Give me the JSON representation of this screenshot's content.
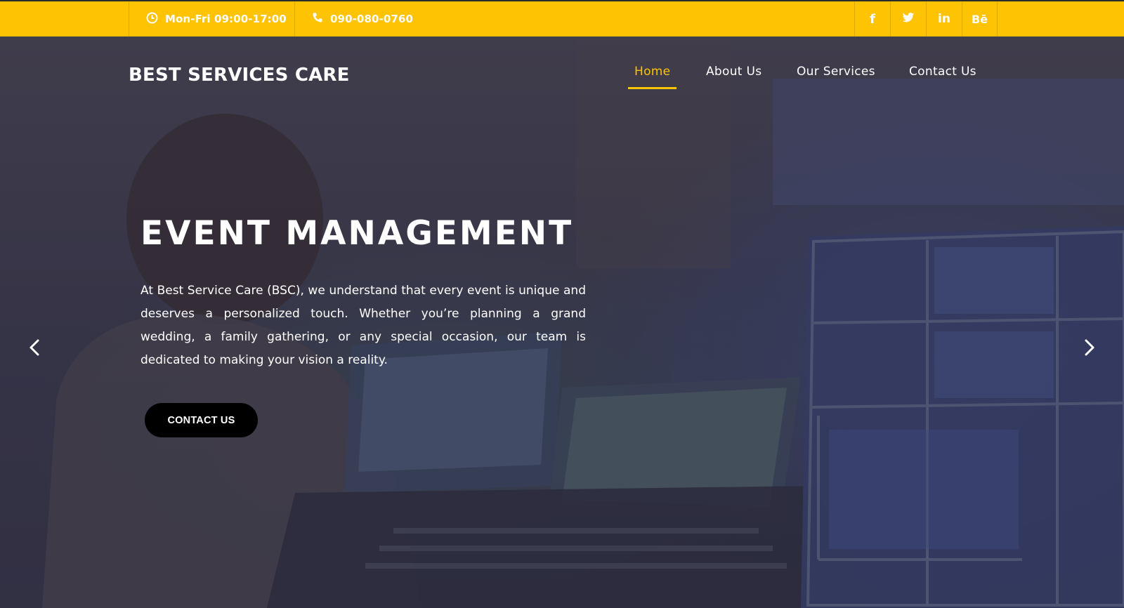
{
  "topbar": {
    "hours": "Mon-Fri 09:00-17:00",
    "phone": "090-080-0760",
    "social": {
      "facebook": "f",
      "twitter": "twitter-icon",
      "linkedin": "in",
      "behance": "Bē"
    }
  },
  "brand": {
    "logo": "BEST SERVICES CARE"
  },
  "nav": {
    "items": [
      {
        "label": "Home",
        "active": true
      },
      {
        "label": "About Us",
        "active": false
      },
      {
        "label": "Our Services",
        "active": false
      },
      {
        "label": "Contact Us",
        "active": false
      }
    ]
  },
  "hero": {
    "title": "EVENT MANAGEMENT",
    "description": "At Best Service Care (BSC), we understand that every event is unique and deserves a personalized touch. Whether you’re planning a grand wedding, a family gathering, or any special occasion, our team is dedicated to making your vision a reality.",
    "cta_label": "CONTACT US"
  },
  "colors": {
    "accent": "#fec303",
    "button_bg": "#000000",
    "text": "#ffffff"
  }
}
